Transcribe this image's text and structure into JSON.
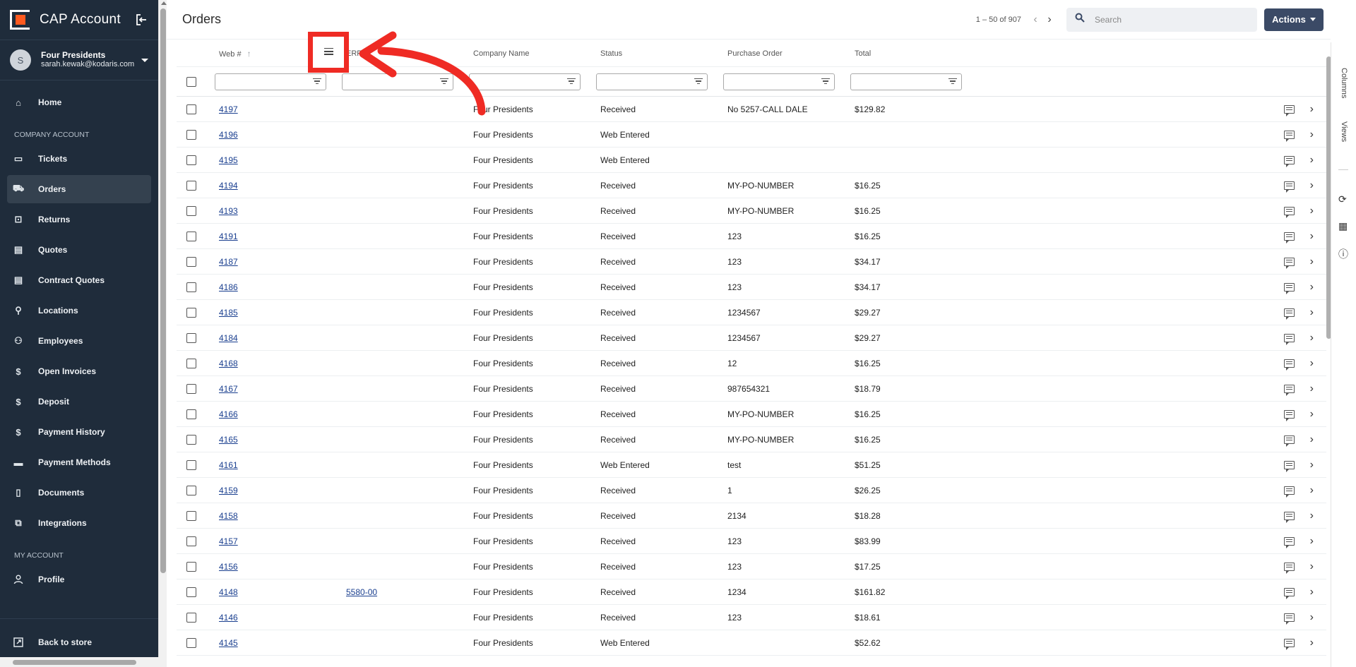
{
  "sidebar": {
    "brand_title": "CAP Account",
    "user": {
      "initial": "S",
      "name": "Four Presidents",
      "email": "sarah.kewak@kodaris.com"
    },
    "nav_top": [
      {
        "label": "Home",
        "icon": "home-icon"
      }
    ],
    "company_section_label": "COMPANY ACCOUNT",
    "company_items": [
      {
        "label": "Tickets",
        "icon": "ticket-icon"
      },
      {
        "label": "Orders",
        "icon": "truck-icon",
        "active": true
      },
      {
        "label": "Returns",
        "icon": "return-icon"
      },
      {
        "label": "Quotes",
        "icon": "clipboard-icon"
      },
      {
        "label": "Contract Quotes",
        "icon": "clipboard-icon"
      },
      {
        "label": "Locations",
        "icon": "location-pin-icon"
      },
      {
        "label": "Employees",
        "icon": "people-icon"
      },
      {
        "label": "Open Invoices",
        "icon": "dollar-icon"
      },
      {
        "label": "Deposit",
        "icon": "dollar-icon"
      },
      {
        "label": "Payment History",
        "icon": "dollar-icon"
      },
      {
        "label": "Payment Methods",
        "icon": "credit-card-icon"
      },
      {
        "label": "Documents",
        "icon": "document-icon"
      },
      {
        "label": "Integrations",
        "icon": "integration-icon"
      }
    ],
    "my_section_label": "MY ACCOUNT",
    "my_items": [
      {
        "label": "Profile",
        "icon": "person-icon"
      }
    ],
    "footer_label": "Back to store"
  },
  "header": {
    "title": "Orders",
    "pager_text": "1 – 50 of 907",
    "search_placeholder": "Search",
    "actions_label": "Actions"
  },
  "table": {
    "columns": [
      "Web #",
      "ERP #",
      "Company Name",
      "Status",
      "Purchase Order",
      "Total"
    ],
    "rows": [
      {
        "web": "4197",
        "erp": "",
        "company": "Four Presidents",
        "status": "Received",
        "po": "No 5257-CALL DALE",
        "total": "$129.82"
      },
      {
        "web": "4196",
        "erp": "",
        "company": "Four Presidents",
        "status": "Web Entered",
        "po": "",
        "total": ""
      },
      {
        "web": "4195",
        "erp": "",
        "company": "Four Presidents",
        "status": "Web Entered",
        "po": "",
        "total": ""
      },
      {
        "web": "4194",
        "erp": "",
        "company": "Four Presidents",
        "status": "Received",
        "po": "MY-PO-NUMBER",
        "total": "$16.25"
      },
      {
        "web": "4193",
        "erp": "",
        "company": "Four Presidents",
        "status": "Received",
        "po": "MY-PO-NUMBER",
        "total": "$16.25"
      },
      {
        "web": "4191",
        "erp": "",
        "company": "Four Presidents",
        "status": "Received",
        "po": "123",
        "total": "$16.25"
      },
      {
        "web": "4187",
        "erp": "",
        "company": "Four Presidents",
        "status": "Received",
        "po": "123",
        "total": "$34.17"
      },
      {
        "web": "4186",
        "erp": "",
        "company": "Four Presidents",
        "status": "Received",
        "po": "123",
        "total": "$34.17"
      },
      {
        "web": "4185",
        "erp": "",
        "company": "Four Presidents",
        "status": "Received",
        "po": "1234567",
        "total": "$29.27"
      },
      {
        "web": "4184",
        "erp": "",
        "company": "Four Presidents",
        "status": "Received",
        "po": "1234567",
        "total": "$29.27"
      },
      {
        "web": "4168",
        "erp": "",
        "company": "Four Presidents",
        "status": "Received",
        "po": "12",
        "total": "$16.25"
      },
      {
        "web": "4167",
        "erp": "",
        "company": "Four Presidents",
        "status": "Received",
        "po": "987654321",
        "total": "$18.79"
      },
      {
        "web": "4166",
        "erp": "",
        "company": "Four Presidents",
        "status": "Received",
        "po": "MY-PO-NUMBER",
        "total": "$16.25"
      },
      {
        "web": "4165",
        "erp": "",
        "company": "Four Presidents",
        "status": "Received",
        "po": "MY-PO-NUMBER",
        "total": "$16.25"
      },
      {
        "web": "4161",
        "erp": "",
        "company": "Four Presidents",
        "status": "Web Entered",
        "po": "test",
        "total": "$51.25"
      },
      {
        "web": "4159",
        "erp": "",
        "company": "Four Presidents",
        "status": "Received",
        "po": "1",
        "total": "$26.25"
      },
      {
        "web": "4158",
        "erp": "",
        "company": "Four Presidents",
        "status": "Received",
        "po": "2134",
        "total": "$18.28"
      },
      {
        "web": "4157",
        "erp": "",
        "company": "Four Presidents",
        "status": "Received",
        "po": "123",
        "total": "$83.99"
      },
      {
        "web": "4156",
        "erp": "",
        "company": "Four Presidents",
        "status": "Received",
        "po": "123",
        "total": "$17.25"
      },
      {
        "web": "4148",
        "erp": "5580-00",
        "company": "Four Presidents",
        "status": "Received",
        "po": "1234",
        "total": "$161.82"
      },
      {
        "web": "4146",
        "erp": "",
        "company": "Four Presidents",
        "status": "Received",
        "po": "123",
        "total": "$18.61"
      },
      {
        "web": "4145",
        "erp": "",
        "company": "Four Presidents",
        "status": "Web Entered",
        "po": "",
        "total": "$52.62"
      }
    ]
  },
  "rail": {
    "columns_label": "Columns",
    "views_label": "Views"
  },
  "colors": {
    "sidebar_bg": "#1f2c3b",
    "accent": "#3b4a66",
    "annotation": "#ef2b24",
    "brand_orange": "#ff5a1f"
  }
}
